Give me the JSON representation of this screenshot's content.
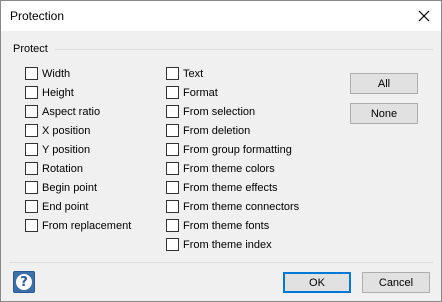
{
  "dialog": {
    "title": "Protection",
    "group_label": "Protect"
  },
  "left_column": [
    {
      "label": "Width",
      "checked": false
    },
    {
      "label": "Height",
      "checked": false
    },
    {
      "label": "Aspect ratio",
      "checked": false
    },
    {
      "label": "X position",
      "checked": false
    },
    {
      "label": "Y position",
      "checked": false
    },
    {
      "label": "Rotation",
      "checked": false
    },
    {
      "label": "Begin point",
      "checked": false
    },
    {
      "label": "End point",
      "checked": false
    },
    {
      "label": "From replacement",
      "checked": false
    }
  ],
  "right_column": [
    {
      "label": "Text",
      "checked": false
    },
    {
      "label": "Format",
      "checked": false
    },
    {
      "label": "From selection",
      "checked": false
    },
    {
      "label": "From deletion",
      "checked": false
    },
    {
      "label": "From group formatting",
      "checked": false
    },
    {
      "label": "From theme colors",
      "checked": false
    },
    {
      "label": "From theme effects",
      "checked": false
    },
    {
      "label": "From theme connectors",
      "checked": false
    },
    {
      "label": "From theme fonts",
      "checked": false
    },
    {
      "label": "From theme index",
      "checked": false
    }
  ],
  "buttons": {
    "all": "All",
    "none": "None",
    "ok": "OK",
    "cancel": "Cancel",
    "help_glyph": "?"
  },
  "colors": {
    "accent": "#0078d7",
    "help_icon": "#3c6ea8"
  }
}
